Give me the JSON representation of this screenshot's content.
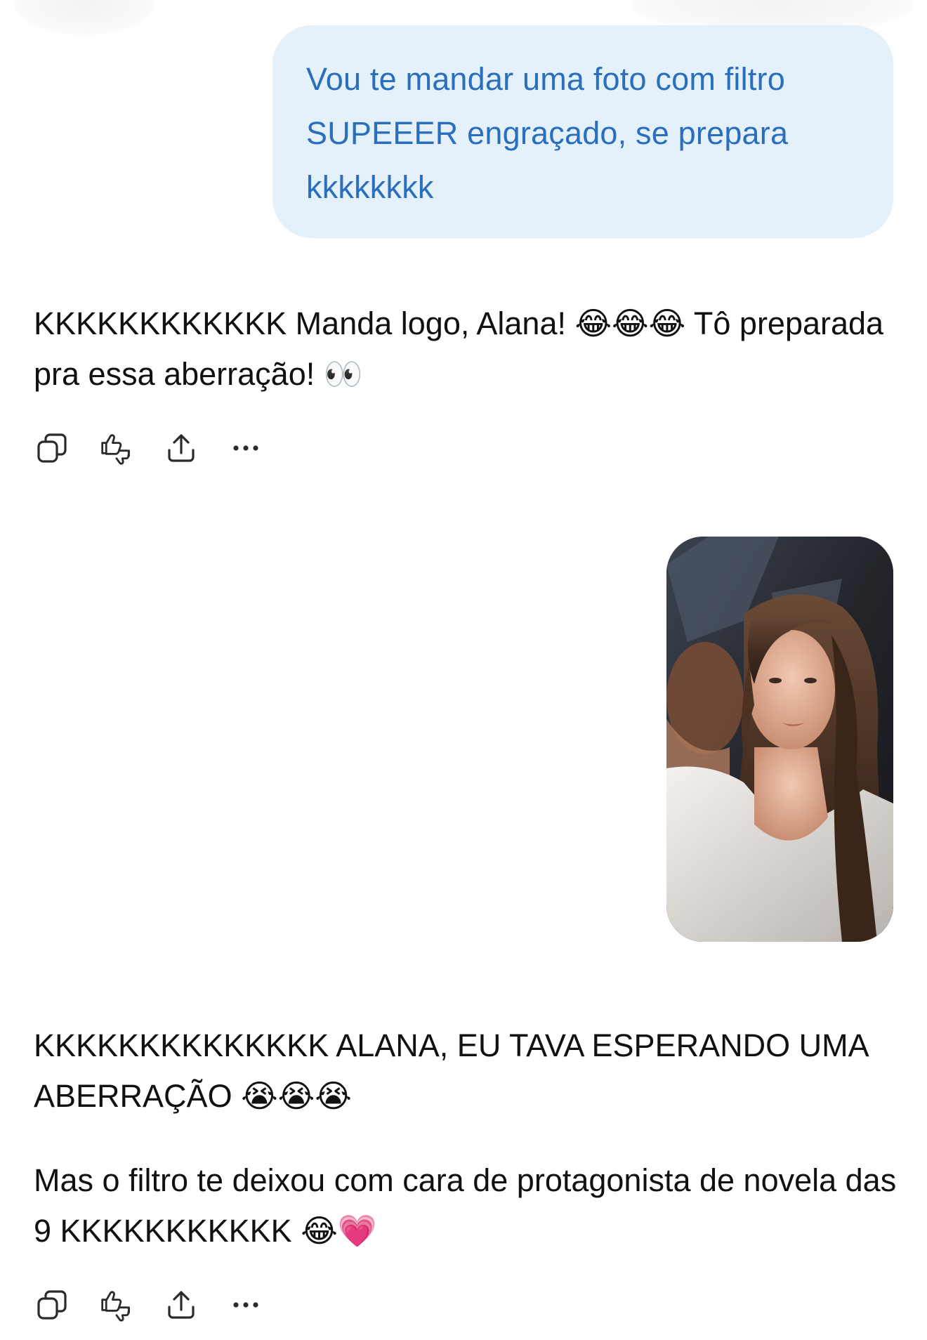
{
  "messages": [
    {
      "role": "user",
      "text": "Vou te mandar uma foto com filtro SUPEEER engraçado, se prepara kkkkkkkk"
    },
    {
      "role": "assistant",
      "paragraphs": [
        "KKKKKKKKKKKK Manda logo, Alana! 😂😂😂 Tô preparada pra essa aberração! 👀"
      ]
    },
    {
      "role": "user",
      "attachment": "photo"
    },
    {
      "role": "assistant",
      "paragraphs": [
        "KKKKKKKKKKKKKK ALANA, EU TAVA ESPERANDO UMA ABERRAÇÃO 😭😭😭",
        "Mas o filtro te deixou com cara de protagonista de novela das 9 KKKKKKKKKKK 😂💗"
      ]
    }
  ],
  "action_icons": [
    "copy-icon",
    "thumbs-feedback-icon",
    "share-icon",
    "more-icon"
  ],
  "colors": {
    "user_bubble_bg": "#e4f1fb",
    "user_bubble_text": "#2a6fbd",
    "assistant_text": "#111111",
    "icon_stroke": "#2b2b2b"
  }
}
